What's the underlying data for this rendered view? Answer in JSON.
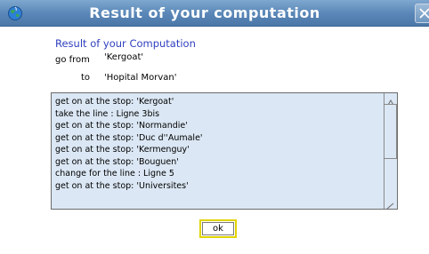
{
  "window": {
    "title": "Result of your computation",
    "icon": "app-globe-icon",
    "close_icon": "close-icon"
  },
  "dialog": {
    "heading": "Result of your Computation",
    "from_label": "go from",
    "from_value": "'Kergoat'",
    "to_label": "to",
    "to_value": "'Hopital Morvan'",
    "itinerary": [
      "get on at the stop: 'Kergoat'",
      "take the line : Ligne 3bis",
      "get on at the stop: 'Normandie'",
      "get on at the stop: 'Duc d''Aumale'",
      "get on at the stop: 'Kermenguy'",
      "get on at the stop: 'Bouguen'",
      "change for the line : Ligne 5",
      "get on at the stop: 'Universites'"
    ],
    "ok_label": "ok"
  },
  "colors": {
    "titlebar": "#5b88b8",
    "heading": "#2f3fbf",
    "list_background": "#dbe7f4",
    "ok_focus": "#e0d400"
  }
}
